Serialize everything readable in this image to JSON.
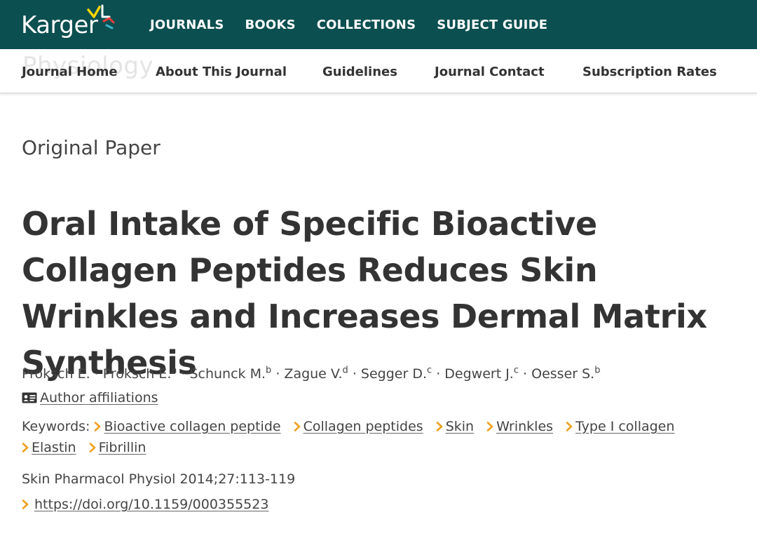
{
  "brand": {
    "name": "Karger"
  },
  "top_nav": [
    {
      "label": "JOURNALS"
    },
    {
      "label": "BOOKS"
    },
    {
      "label": "COLLECTIONS"
    },
    {
      "label": "SUBJECT GUIDE"
    }
  ],
  "journal": {
    "watermark": "Physiology"
  },
  "sub_nav": [
    {
      "label": "Journal Home"
    },
    {
      "label": "About This Journal"
    },
    {
      "label": "Guidelines"
    },
    {
      "label": "Journal Contact"
    },
    {
      "label": "Subscription Rates"
    }
  ],
  "article": {
    "type": "Original Paper",
    "title": "Oral Intake of Specific Bioactive Collagen Peptides Reduces Skin Wrinkles and Increases Dermal Matrix Synthesis",
    "authors": [
      {
        "name": "Proksch E.",
        "sup": ""
      },
      {
        "name": "Proksch E.",
        "sup": "a"
      },
      {
        "name": "Schunck M.",
        "sup": "b"
      },
      {
        "name": "Zague V.",
        "sup": "d"
      },
      {
        "name": "Segger D.",
        "sup": "c"
      },
      {
        "name": "Degwert J.",
        "sup": "c"
      },
      {
        "name": "Oesser S.",
        "sup": "b"
      }
    ],
    "affiliations_label": "Author affiliations",
    "keywords_label": "Keywords:",
    "keywords": [
      "Bioactive collagen peptide",
      "Collagen peptides",
      "Skin",
      "Wrinkles",
      "Type I collagen",
      "Elastin",
      "Fibrillin"
    ],
    "citation": "Skin Pharmacol Physiol 2014;27:113-119",
    "doi": "https://doi.org/10.1159/000355523"
  },
  "colors": {
    "header_bg": "#0b4f50",
    "accent": "#f0a020",
    "text": "#333333"
  },
  "icons": {
    "logo_mark": "karger-logo-mark",
    "affiliations": "id-card-icon",
    "keyword_bullet": "chevron-right-icon"
  }
}
